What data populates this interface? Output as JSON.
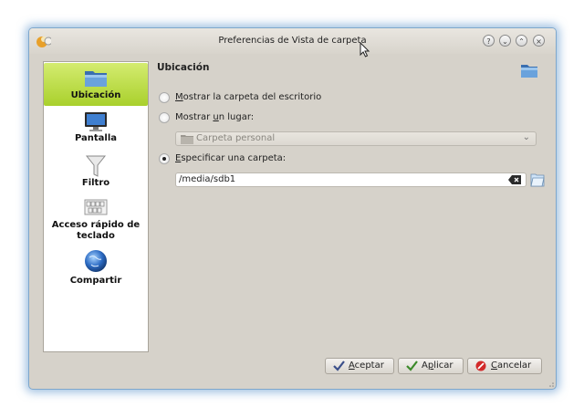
{
  "window": {
    "title": "Preferencias de Vista de carpeta",
    "controls": [
      "help",
      "minimize",
      "maximize",
      "close"
    ]
  },
  "sidebar": {
    "items": [
      {
        "label": "Ubicación",
        "icon": "folder-icon",
        "active": true
      },
      {
        "label": "Pantalla",
        "icon": "monitor-icon"
      },
      {
        "label": "Filtro",
        "icon": "funnel-icon"
      },
      {
        "label": "Acceso rápido de teclado",
        "icon": "keyboard-icon"
      },
      {
        "label": "Compartir",
        "icon": "globe-icon"
      }
    ]
  },
  "content": {
    "title": "Ubicación",
    "options": [
      {
        "prefix": "",
        "accel": "M",
        "rest": "ostrar la carpeta del escritorio",
        "checked": false
      },
      {
        "prefix": "Mostrar ",
        "accel": "u",
        "rest": "n lugar:",
        "checked": false
      },
      {
        "prefix": "",
        "accel": "E",
        "rest": "specificar una carpeta:",
        "checked": true
      }
    ],
    "place_combo": {
      "value": "Carpeta personal",
      "enabled": false
    },
    "folder_input": {
      "value": "/media/sdb1"
    }
  },
  "buttons": {
    "ok": {
      "prefix": "",
      "accel": "A",
      "rest": "ceptar"
    },
    "apply": {
      "prefix": "A",
      "accel": "p",
      "rest": "licar"
    },
    "cancel": {
      "prefix": "",
      "accel": "C",
      "rest": "ancelar"
    }
  },
  "colors": {
    "accent": "#b5d83a",
    "window_bg": "#d6d2ca",
    "window_border": "#7ea7cc"
  }
}
